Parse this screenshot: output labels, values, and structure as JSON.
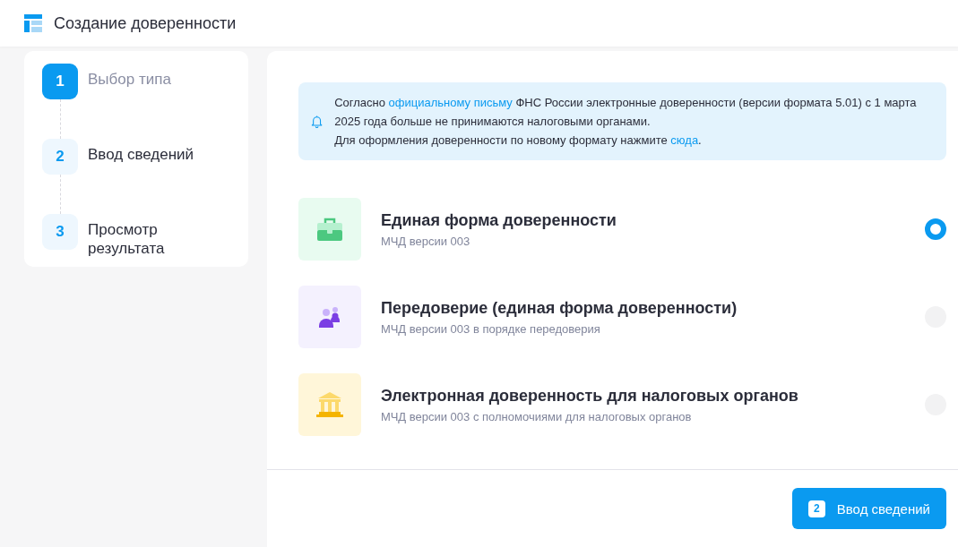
{
  "header": {
    "title": "Создание доверенности"
  },
  "steps": [
    {
      "number": "1",
      "label": "Выбор типа",
      "selected": true
    },
    {
      "number": "2",
      "label": "Ввод сведений",
      "selected": false
    },
    {
      "number": "3",
      "label": "Просмотр результата",
      "selected": false
    }
  ],
  "notice": {
    "paragraphs": [
      [
        {
          "kind": "text",
          "text": "Согласно "
        },
        {
          "kind": "link",
          "text": "официальному письму"
        },
        {
          "kind": "text",
          "text": " ФНС России электронные доверенности (версии формата 5.01) с 1 марта 2025 года больше не принимаются налоговыми органами."
        }
      ],
      [
        {
          "kind": "text",
          "text": "Для оформления доверенности по новому формату нажмите "
        },
        {
          "kind": "link",
          "text": "сюда"
        },
        {
          "kind": "text",
          "text": "."
        }
      ]
    ]
  },
  "options": [
    {
      "kind": "briefcase",
      "title": "Единая форма доверенности",
      "subtitle": "МЧД версии 003",
      "selected": true
    },
    {
      "kind": "people",
      "title": "Передоверие (единая форма доверенности)",
      "subtitle": "МЧД версии 003 в порядке передоверия",
      "selected": false
    },
    {
      "kind": "bank",
      "title": "Электронная доверенность для налоговых органов",
      "subtitle": "МЧД версии 003 с полномочиями для налоговых органов",
      "selected": false
    }
  ],
  "next_button": {
    "number": "2",
    "label": "Ввод сведений"
  }
}
